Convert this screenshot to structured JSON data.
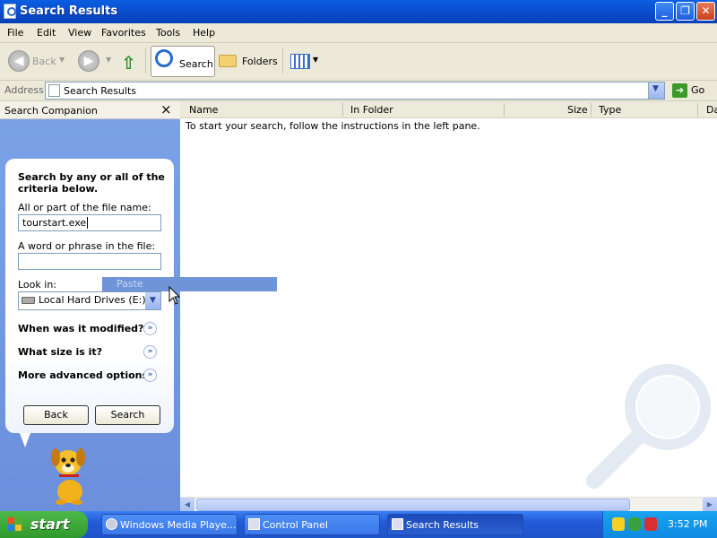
{
  "window": {
    "title": "Search Results"
  },
  "menu": [
    "File",
    "Edit",
    "View",
    "Favorites",
    "Tools",
    "Help"
  ],
  "toolbar": {
    "back": "Back",
    "search": "Search",
    "folders": "Folders"
  },
  "address": {
    "label": "Address",
    "value": "Search Results",
    "go": "Go"
  },
  "companion": {
    "header": "Search Companion",
    "close": "×",
    "intro": "Search by any or all of the criteria below.",
    "filename_label": "All or part of the file name:",
    "filename_value": "tourstart.exe",
    "phrase_label": "A word or phrase in the file:",
    "phrase_value": "",
    "lookin_label": "Look in:",
    "lookin_value": "Local Hard Drives (E:)",
    "sections": [
      "When was it modified?",
      "What size is it?",
      "More advanced options"
    ],
    "back_button": "Back",
    "search_button": "Search"
  },
  "list": {
    "columns": [
      "Name",
      "In Folder",
      "Size",
      "Type",
      "Da"
    ],
    "message": "To start your search, follow the instructions in the left pane."
  },
  "context_menu": {
    "item": "Paste"
  },
  "taskbar": {
    "start": "start",
    "tasks": [
      "Windows Media Playe...",
      "Control Panel",
      "Search Results"
    ],
    "clock": "3:52 PM"
  }
}
